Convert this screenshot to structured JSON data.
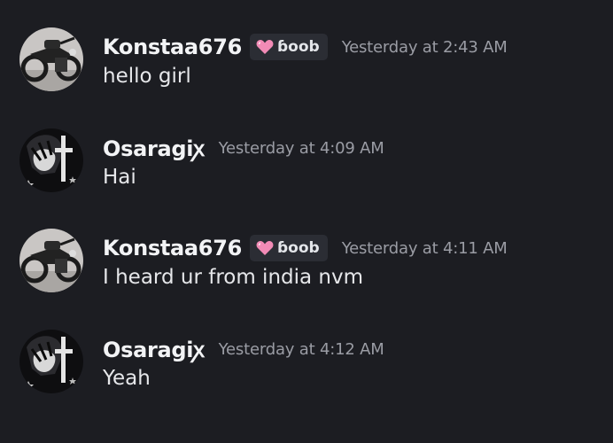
{
  "messages": [
    {
      "author": "Konstaa676",
      "tag": "ɓoob",
      "timestamp": "Yesterday at 2:43 AM",
      "text": "hello girl"
    },
    {
      "author": "Osaragiꭗ",
      "timestamp": "Yesterday at 4:09 AM",
      "text": "Hai"
    },
    {
      "author": "Konstaa676",
      "tag": "ɓoob",
      "timestamp": "Yesterday at 4:11 AM",
      "text": "I heard ur from india nvm"
    },
    {
      "author": "Osaragiꭗ",
      "timestamp": "Yesterday at 4:12 AM",
      "text": "Yeah"
    }
  ],
  "colors": {
    "background": "#1c1d22",
    "username": "#f2f3f5",
    "tag_background": "#2b2d34",
    "heart": "#f28bb6",
    "timestamp": "#9a9ca4",
    "message_text": "#e6e7ea"
  },
  "icons": {
    "tag_icon": "pink-heart-icon"
  }
}
